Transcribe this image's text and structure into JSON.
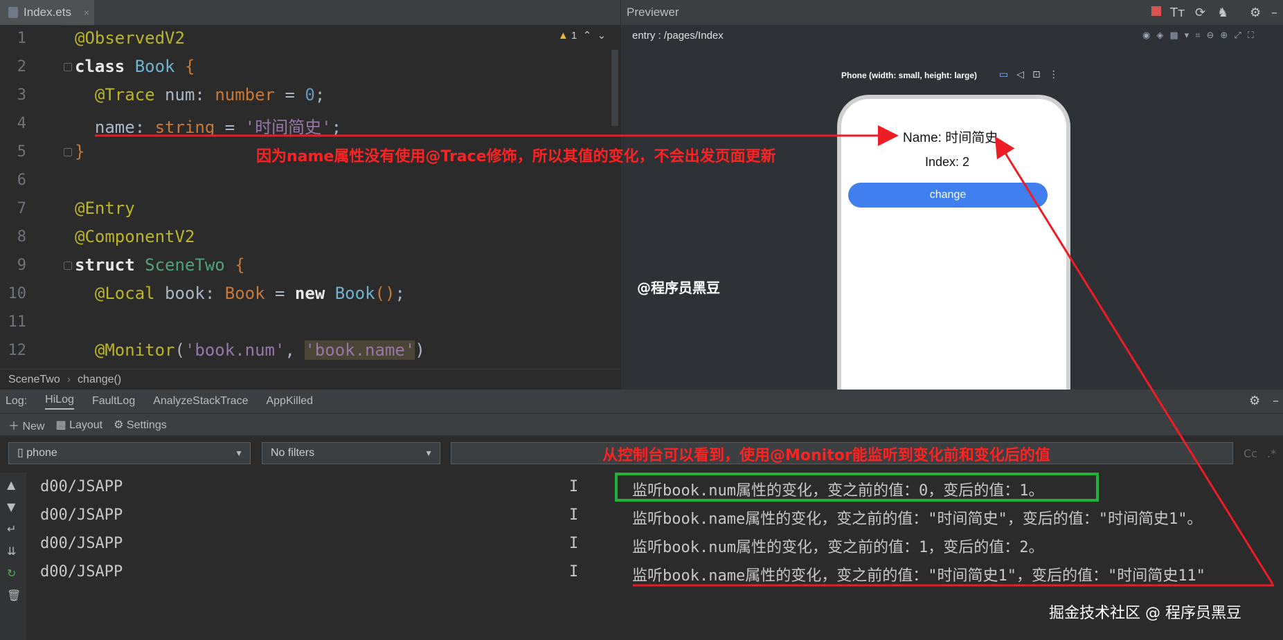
{
  "editor": {
    "tab_label": "Index.ets",
    "tab_close": "×",
    "warning_count": "1",
    "line_numbers": [
      "1",
      "2",
      "3",
      "4",
      "5",
      "6",
      "7",
      "8",
      "9",
      "10",
      "11",
      "12"
    ],
    "breadcrumb": [
      "SceneTwo",
      "change()"
    ]
  },
  "previewer": {
    "title": "Previewer",
    "path": "entry : /pages/Index",
    "device_label": "Phone (width: small, height: large)",
    "phone": {
      "name_text": "Name: 时间简史",
      "index_text": "Index: 2",
      "button_label": "change"
    },
    "watermark": "@程序员黑豆"
  },
  "log": {
    "label": "Log:",
    "tabs": [
      "HiLog",
      "FaultLog",
      "AnalyzeStackTrace",
      "AppKilled"
    ],
    "toolbar": {
      "new": "New",
      "layout": "Layout",
      "settings": "Settings"
    },
    "device_select": "phone",
    "filter_select": "No filters",
    "regex_hint": "Cc",
    "rows": [
      {
        "tag": "d00/JSAPP",
        "level": "I",
        "msg": "监听book.num属性的变化，变之前的值：0，变后的值：1。"
      },
      {
        "tag": "d00/JSAPP",
        "level": "I",
        "msg": "监听book.name属性的变化，变之前的值：\"时间简史\"，变后的值：\"时间简史1\"。"
      },
      {
        "tag": "d00/JSAPP",
        "level": "I",
        "msg": "监听book.num属性的变化，变之前的值：1，变后的值：2。"
      },
      {
        "tag": "d00/JSAPP",
        "level": "I",
        "msg": "监听book.name属性的变化，变之前的值：\"时间简史1\"，变后的值：\"时间简史11\""
      }
    ]
  },
  "annotations": {
    "note1": "因为name属性没有使用@Trace修饰，所以其值的变化，不会出发页面更新",
    "note2": "从控制台可以看到，使用@Monitor能监听到变化前和变化后的值",
    "footer_watermark": "掘金技术社区 @ 程序员黑豆"
  },
  "colors": {
    "annotation_red": "#ff2222",
    "highlight_green": "#1fb33a",
    "phone_button": "#3f7ff0"
  }
}
